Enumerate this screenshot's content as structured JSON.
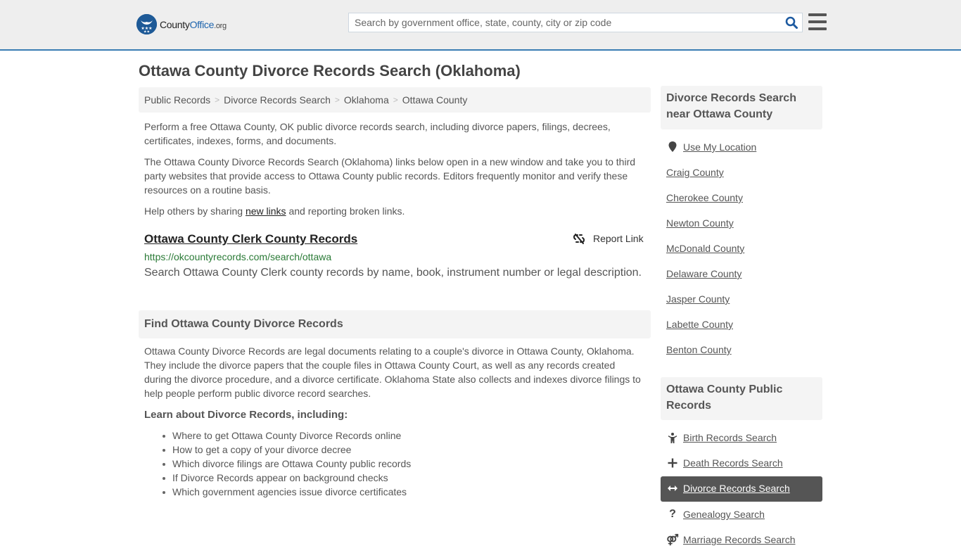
{
  "header": {
    "logo_main": "County",
    "logo_accent": "Office",
    "logo_suffix": ".org",
    "search_placeholder": "Search by government office, state, county, city or zip code",
    "search_value": ""
  },
  "page": {
    "title": "Ottawa County Divorce Records Search (Oklahoma)"
  },
  "breadcrumb": [
    {
      "label": "Public Records"
    },
    {
      "label": "Divorce Records Search"
    },
    {
      "label": "Oklahoma"
    },
    {
      "label": "Ottawa County"
    }
  ],
  "breadcrumb_separator": ">",
  "intro": {
    "p1": "Perform a free Ottawa County, OK public divorce records search, including divorce papers, filings, decrees, certificates, indexes, forms, and documents.",
    "p2": "The Ottawa County Divorce Records Search (Oklahoma) links below open in a new window and take you to third party websites that provide access to Ottawa County public records. Editors frequently monitor and verify these resources on a routine basis.",
    "p3_before": "Help others by sharing ",
    "p3_link": "new links",
    "p3_after": " and reporting broken links."
  },
  "results": [
    {
      "title": "Ottawa County Clerk County Records",
      "url": "https://okcountyrecords.com/search/ottawa",
      "description": "Search Ottawa County Clerk county records by name, book, instrument number or legal description.",
      "report_label": "Report Link"
    }
  ],
  "find_section": {
    "heading": "Find Ottawa County Divorce Records",
    "body": "Ottawa County Divorce Records are legal documents relating to a couple's divorce in Ottawa County, Oklahoma. They include the divorce papers that the couple files in Ottawa County Court, as well as any records created during the divorce procedure, and a divorce certificate. Oklahoma State also collects and indexes divorce filings to help people perform public divorce record searches.",
    "learn_heading": "Learn about Divorce Records, including:",
    "learn_items": [
      "Where to get Ottawa County Divorce Records online",
      "How to get a copy of your divorce decree",
      "Which divorce filings are Ottawa County public records",
      "If Divorce Records appear on background checks",
      "Which government agencies issue divorce certificates"
    ]
  },
  "sidebar": {
    "nearby_heading": "Divorce Records Search near Ottawa County",
    "use_location": "Use My Location",
    "nearby": [
      "Craig County",
      "Cherokee County",
      "Newton County",
      "McDonald County",
      "Delaware County",
      "Jasper County",
      "Labette County",
      "Benton County"
    ],
    "public_heading": "Ottawa County Public Records",
    "public_records": [
      {
        "label": "Birth Records Search",
        "icon": "child-icon",
        "glyph": "Ÿ"
      },
      {
        "label": "Death Records Search",
        "icon": "plus-icon",
        "glyph": "+"
      },
      {
        "label": "Divorce Records Search",
        "icon": "arrows-horizontal-icon",
        "glyph": "↔",
        "active": true
      },
      {
        "label": "Genealogy Search",
        "icon": "question-icon",
        "glyph": "?"
      },
      {
        "label": "Marriage Records Search",
        "icon": "marriage-icon",
        "glyph": "⚤"
      }
    ]
  },
  "colors": {
    "brand_blue": "#1d64ad",
    "header_border": "#3a7db3",
    "url_green": "#2a7a36",
    "active_bg": "#555555"
  }
}
